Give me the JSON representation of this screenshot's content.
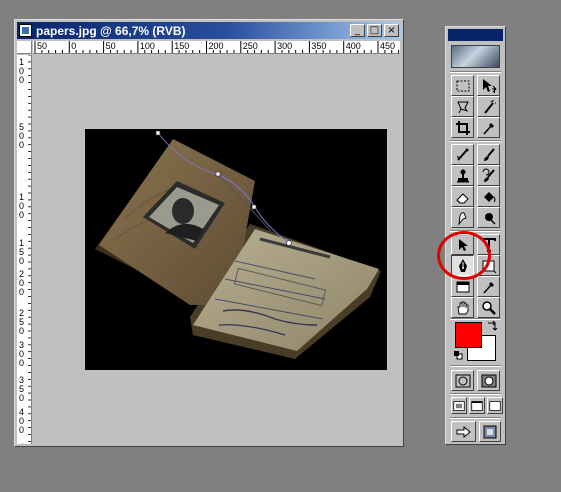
{
  "window": {
    "title": "papers.jpg @ 66,7% (RVB)",
    "minimize_glyph": "_",
    "maximize_glyph": "□",
    "close_glyph": "×"
  },
  "rulers": {
    "horizontal_ticks": [
      "50",
      "0",
      "50",
      "100",
      "150",
      "200",
      "250",
      "300",
      "350",
      "400",
      "450"
    ],
    "vertical_ticks": [
      "1",
      "0",
      "0",
      "5",
      "0",
      "0",
      "1",
      "0",
      "0",
      "1",
      "5",
      "0",
      "2",
      "0",
      "0",
      "2",
      "5",
      "0",
      "3",
      "0",
      "0",
      "3",
      "5",
      "0",
      "4",
      "0",
      "0",
      "4",
      "5"
    ]
  },
  "toolbox": {
    "tools": [
      {
        "name": "marquee-tool",
        "icon": "dashed-rect-icon"
      },
      {
        "name": "move-tool",
        "icon": "move-icon"
      },
      {
        "name": "lasso-tool",
        "icon": "lasso-icon"
      },
      {
        "name": "magic-wand-tool",
        "icon": "magic-wand-icon"
      },
      {
        "name": "crop-tool",
        "icon": "crop-icon"
      },
      {
        "name": "eyedropper-tool",
        "icon": "eyedropper-icon"
      },
      {
        "name": "airbrush-tool",
        "icon": "airbrush-icon"
      },
      {
        "name": "paintbrush-tool",
        "icon": "paintbrush-icon"
      },
      {
        "name": "stamp-tool",
        "icon": "stamp-icon"
      },
      {
        "name": "history-brush-tool",
        "icon": "history-brush-icon"
      },
      {
        "name": "eraser-tool",
        "icon": "eraser-icon"
      },
      {
        "name": "paint-bucket-tool",
        "icon": "paint-bucket-icon"
      },
      {
        "name": "smudge-tool",
        "icon": "smudge-icon"
      },
      {
        "name": "burn-tool",
        "icon": "burn-icon"
      },
      {
        "name": "path-selection-tool",
        "icon": "arrow-icon"
      },
      {
        "name": "type-tool",
        "icon": "type-icon"
      },
      {
        "name": "pen-tool",
        "icon": "pen-icon"
      },
      {
        "name": "shape-tool",
        "icon": "rectangle-icon"
      },
      {
        "name": "notes-tool",
        "icon": "notes-icon"
      },
      {
        "name": "measure-eyedropper-tool",
        "icon": "eyedropper-icon"
      },
      {
        "name": "hand-tool",
        "icon": "hand-icon"
      },
      {
        "name": "zoom-tool",
        "icon": "magnifier-icon"
      }
    ],
    "foreground_color": "#ff0000",
    "background_color": "#ffffff",
    "selected_tool": "pen-tool",
    "highlight_color": "#e00000"
  }
}
